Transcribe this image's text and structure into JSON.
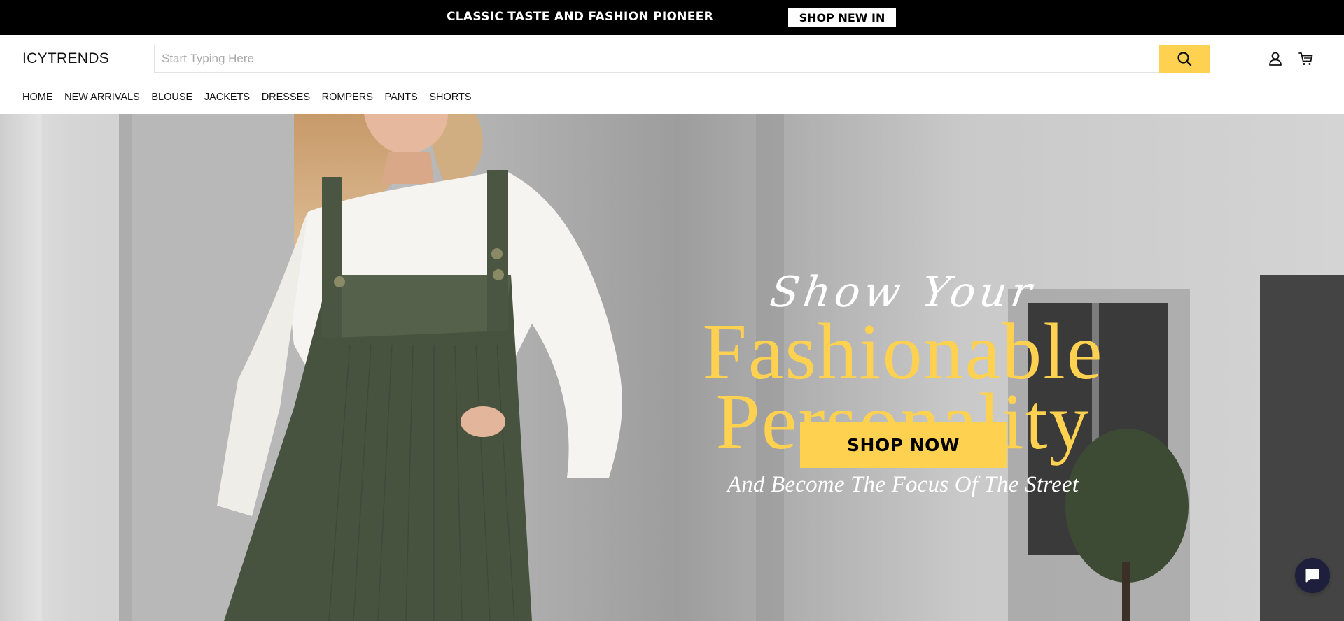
{
  "announcement": {
    "text": "CLASSIC TASTE AND FASHION PIONEER",
    "button_label": "SHOP NEW IN"
  },
  "header": {
    "logo": "ICYTRENDS",
    "search": {
      "placeholder": "Start Typing Here",
      "value": ""
    },
    "search_icon": "search-icon",
    "icons": [
      "user-icon",
      "cart-icon"
    ]
  },
  "nav": {
    "items": [
      {
        "label": "HOME"
      },
      {
        "label": "NEW ARRIVALS"
      },
      {
        "label": "BLOUSE"
      },
      {
        "label": "JACKETS"
      },
      {
        "label": "DRESSES"
      },
      {
        "label": "ROMPERS"
      },
      {
        "label": "PANTS"
      },
      {
        "label": "SHORTS"
      }
    ]
  },
  "hero": {
    "script_line": "Show Your",
    "title_line1": "Fashionable",
    "title_line2": "Personality",
    "subtitle": "And Become The Focus Of The Street",
    "cta_label": "SHOP NOW"
  },
  "chat": {
    "icon": "chat-bubble-icon"
  },
  "colors": {
    "accent": "#ffd150",
    "announcement_bg": "#000000",
    "chat_bg": "#1d1f3c",
    "overall_green": "#47533f"
  }
}
